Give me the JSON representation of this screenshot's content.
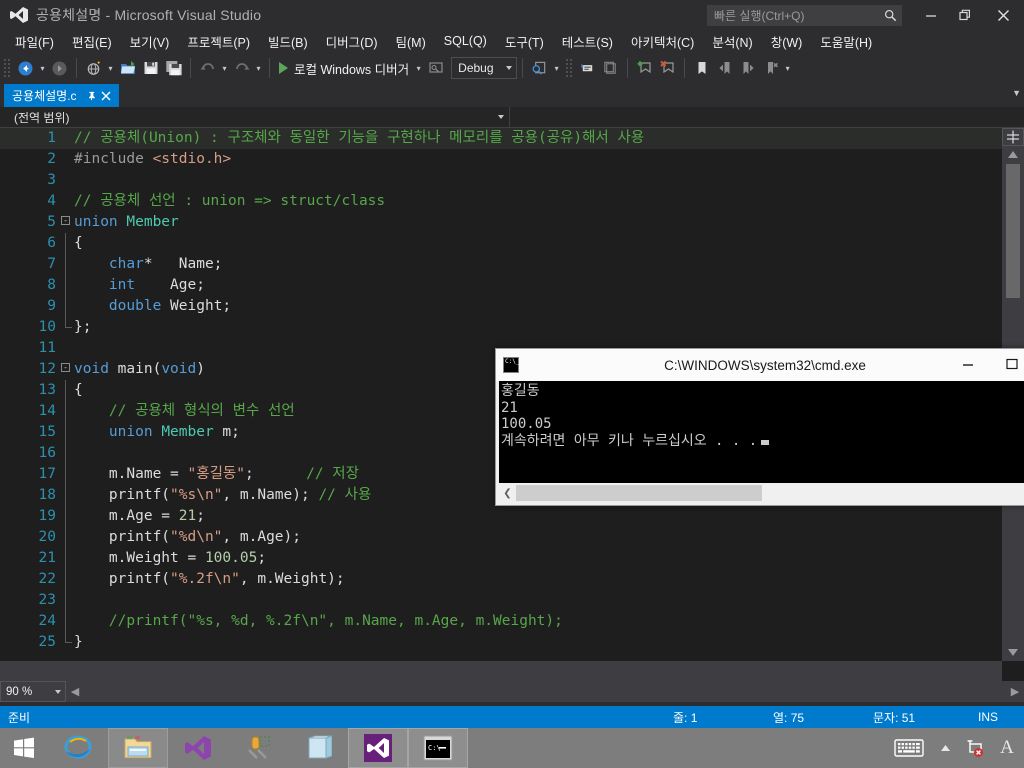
{
  "window": {
    "app_title": "공용체설명 - Microsoft Visual Studio",
    "doc_name": "공용체설명",
    "app_name": "Microsoft Visual Studio",
    "logo_icon": "visual-studio-logo-icon",
    "minimize_icon": "minimize-icon",
    "maximize_icon": "restore-icon",
    "close_icon": "close-icon",
    "accent_color": "#007acc"
  },
  "quick_launch": {
    "placeholder": "빠른 실행(Ctrl+Q)",
    "value": "",
    "icon": "search-icon"
  },
  "menubar": {
    "items": [
      {
        "label": "파일(F)"
      },
      {
        "label": "편집(E)"
      },
      {
        "label": "보기(V)"
      },
      {
        "label": "프로젝트(P)"
      },
      {
        "label": "빌드(B)"
      },
      {
        "label": "디버그(D)"
      },
      {
        "label": "팀(M)"
      },
      {
        "label": "SQL(Q)"
      },
      {
        "label": "도구(T)"
      },
      {
        "label": "테스트(S)"
      },
      {
        "label": "아키텍처(C)"
      },
      {
        "label": "분석(N)"
      },
      {
        "label": "창(W)"
      },
      {
        "label": "도움말(H)"
      }
    ]
  },
  "toolbar": {
    "nav_back_icon": "navigate-back-icon",
    "nav_forward_icon": "navigate-forward-icon",
    "new_project_icon": "new-project-icon",
    "open_file_icon": "open-file-icon",
    "save_icon": "save-icon",
    "save_all_icon": "save-all-icon",
    "undo_icon": "undo-icon",
    "redo_icon": "redo-icon",
    "run_label": "로컬 Windows 디버거",
    "run_icon": "play-icon",
    "attach_icon": "attach-to-process-icon",
    "config_value": "Debug",
    "find_icon": "find-in-files-icon",
    "comment_icon": "comment-selection-icon",
    "uncomment_icon": "uncomment-selection-icon",
    "add_bookmark_icon": "add-bookmark-icon",
    "remove_bookmark_icon": "remove-bookmark-icon",
    "bookmark_icon": "bookmark-icon",
    "prev_bookmark_icon": "previous-bookmark-icon",
    "next_bookmark_icon": "next-bookmark-icon",
    "clear_bookmarks_icon": "clear-bookmarks-icon"
  },
  "tabs": {
    "active": {
      "label": "공용체설명.c",
      "pin_icon": "pin-icon",
      "close_icon": "close-icon"
    },
    "overflow_icon": "chevron-down-icon"
  },
  "navbar": {
    "scope": "(전역 범위)",
    "caret_icon": "chevron-down-icon"
  },
  "editor": {
    "zoom": "90 %",
    "scroll_up_icon": "scroll-up-arrow-icon",
    "scroll_down_icon": "scroll-down-arrow-icon",
    "split_icon": "split-view-icon",
    "hscroll_left_icon": "scroll-left-arrow-icon",
    "hscroll_right_icon": "scroll-right-arrow-icon",
    "lines": [
      {
        "n": "1",
        "selected": true,
        "fold": "",
        "guide": "",
        "tokens": [
          {
            "t": "// 공용체(Union) : 구조체와 동일한 기능을 구현하나 메모리를 공용(공유)해서 사용",
            "c": "cm"
          }
        ]
      },
      {
        "n": "2",
        "selected": false,
        "fold": "",
        "guide": "",
        "tokens": [
          {
            "t": "#include ",
            "c": "pp"
          },
          {
            "t": "<stdio.h>",
            "c": "ppi"
          }
        ]
      },
      {
        "n": "3",
        "selected": false,
        "fold": "",
        "guide": "",
        "tokens": []
      },
      {
        "n": "4",
        "selected": false,
        "fold": "",
        "guide": "",
        "tokens": [
          {
            "t": "// 공용체 선언 : union => struct/class",
            "c": "cm"
          }
        ]
      },
      {
        "n": "5",
        "selected": false,
        "fold": "-",
        "guide": "",
        "tokens": [
          {
            "t": "union",
            "c": "kw"
          },
          {
            "t": " ",
            "c": "id"
          },
          {
            "t": "Member",
            "c": "ty"
          }
        ]
      },
      {
        "n": "6",
        "selected": false,
        "fold": "",
        "guide": "line",
        "tokens": [
          {
            "t": "{",
            "c": "id"
          }
        ]
      },
      {
        "n": "7",
        "selected": false,
        "fold": "",
        "guide": "line",
        "tokens": [
          {
            "t": "    ",
            "c": "id"
          },
          {
            "t": "char",
            "c": "kw"
          },
          {
            "t": "*",
            "c": "id"
          },
          {
            "t": "   Name;",
            "c": "id"
          }
        ]
      },
      {
        "n": "8",
        "selected": false,
        "fold": "",
        "guide": "line",
        "tokens": [
          {
            "t": "    ",
            "c": "id"
          },
          {
            "t": "int",
            "c": "kw"
          },
          {
            "t": "    Age;",
            "c": "id"
          }
        ]
      },
      {
        "n": "9",
        "selected": false,
        "fold": "",
        "guide": "line",
        "tokens": [
          {
            "t": "    ",
            "c": "id"
          },
          {
            "t": "double",
            "c": "kw"
          },
          {
            "t": " Weight;",
            "c": "id"
          }
        ]
      },
      {
        "n": "10",
        "selected": false,
        "fold": "",
        "guide": "end",
        "tokens": [
          {
            "t": "};",
            "c": "id"
          }
        ]
      },
      {
        "n": "11",
        "selected": false,
        "fold": "",
        "guide": "",
        "tokens": []
      },
      {
        "n": "12",
        "selected": false,
        "fold": "-",
        "guide": "",
        "tokens": [
          {
            "t": "void",
            "c": "kw"
          },
          {
            "t": " main(",
            "c": "id"
          },
          {
            "t": "void",
            "c": "kw"
          },
          {
            "t": ")",
            "c": "id"
          }
        ]
      },
      {
        "n": "13",
        "selected": false,
        "fold": "",
        "guide": "line",
        "tokens": [
          {
            "t": "{",
            "c": "id"
          }
        ]
      },
      {
        "n": "14",
        "selected": false,
        "fold": "",
        "guide": "line",
        "tokens": [
          {
            "t": "    ",
            "c": "id"
          },
          {
            "t": "// 공용체 형식의 변수 선언",
            "c": "cm"
          }
        ]
      },
      {
        "n": "15",
        "selected": false,
        "fold": "",
        "guide": "line",
        "tokens": [
          {
            "t": "    ",
            "c": "id"
          },
          {
            "t": "union",
            "c": "kw"
          },
          {
            "t": " ",
            "c": "id"
          },
          {
            "t": "Member",
            "c": "ty"
          },
          {
            "t": " m;",
            "c": "id"
          }
        ]
      },
      {
        "n": "16",
        "selected": false,
        "fold": "",
        "guide": "line",
        "tokens": []
      },
      {
        "n": "17",
        "selected": false,
        "fold": "",
        "guide": "line",
        "tokens": [
          {
            "t": "    m.Name = ",
            "c": "id"
          },
          {
            "t": "\"홍길동\"",
            "c": "st"
          },
          {
            "t": ";      ",
            "c": "id"
          },
          {
            "t": "// 저장",
            "c": "cm"
          }
        ]
      },
      {
        "n": "18",
        "selected": false,
        "fold": "",
        "guide": "line",
        "tokens": [
          {
            "t": "    printf(",
            "c": "id"
          },
          {
            "t": "\"%s\\n\"",
            "c": "st"
          },
          {
            "t": ", m.Name); ",
            "c": "id"
          },
          {
            "t": "// 사용",
            "c": "cm"
          }
        ]
      },
      {
        "n": "19",
        "selected": false,
        "fold": "",
        "guide": "line",
        "tokens": [
          {
            "t": "    m.Age = ",
            "c": "id"
          },
          {
            "t": "21",
            "c": "nu"
          },
          {
            "t": ";",
            "c": "id"
          }
        ]
      },
      {
        "n": "20",
        "selected": false,
        "fold": "",
        "guide": "line",
        "tokens": [
          {
            "t": "    printf(",
            "c": "id"
          },
          {
            "t": "\"%d\\n\"",
            "c": "st"
          },
          {
            "t": ", m.Age);",
            "c": "id"
          }
        ]
      },
      {
        "n": "21",
        "selected": false,
        "fold": "",
        "guide": "line",
        "tokens": [
          {
            "t": "    m.Weight = ",
            "c": "id"
          },
          {
            "t": "100.05",
            "c": "nu"
          },
          {
            "t": ";",
            "c": "id"
          }
        ]
      },
      {
        "n": "22",
        "selected": false,
        "fold": "",
        "guide": "line",
        "tokens": [
          {
            "t": "    printf(",
            "c": "id"
          },
          {
            "t": "\"%.2f\\n\"",
            "c": "st"
          },
          {
            "t": ", m.Weight);",
            "c": "id"
          }
        ]
      },
      {
        "n": "23",
        "selected": false,
        "fold": "",
        "guide": "line",
        "tokens": []
      },
      {
        "n": "24",
        "selected": false,
        "fold": "",
        "guide": "line",
        "tokens": [
          {
            "t": "    //printf(\"%s, %d, %.2f\\n\", m.Name, m.Age, m.Weight);",
            "c": "cm"
          }
        ]
      },
      {
        "n": "25",
        "selected": false,
        "fold": "",
        "guide": "end",
        "tokens": [
          {
            "t": "}",
            "c": "id"
          }
        ]
      }
    ]
  },
  "statusbar": {
    "ready": "준비",
    "line_label": "줄: 1",
    "col_label": "열: 75",
    "char_label": "문자: 51",
    "insert_mode": "INS"
  },
  "console": {
    "title": "C:\\WINDOWS\\system32\\cmd.exe",
    "icon": "cmd-console-icon",
    "minimize_icon": "minimize-icon",
    "maximize_icon": "maximize-icon",
    "output": [
      "홍길동",
      "21",
      "100.05",
      "계속하려면 아무 키나 누르십시오 . . ."
    ],
    "scroll_left_icon": "scroll-left-arrow-icon"
  },
  "taskbar": {
    "start_icon": "windows-start-icon",
    "items": [
      {
        "icon": "internet-explorer-icon",
        "state": "pinned"
      },
      {
        "icon": "file-explorer-icon",
        "state": "running"
      },
      {
        "icon": "visual-studio-icon",
        "state": "pinned"
      },
      {
        "icon": "sql-server-tools-icon",
        "state": "pinned"
      },
      {
        "icon": "notepad-icon",
        "state": "pinned"
      },
      {
        "icon": "visual-studio-window-icon",
        "state": "active"
      },
      {
        "icon": "cmd-window-icon",
        "state": "active"
      }
    ],
    "tray": [
      {
        "icon": "touch-keyboard-icon"
      },
      {
        "icon": "show-hidden-icons-icon"
      },
      {
        "icon": "network-disconnected-icon"
      },
      {
        "icon": "ime-language-icon",
        "label": "A"
      }
    ]
  }
}
